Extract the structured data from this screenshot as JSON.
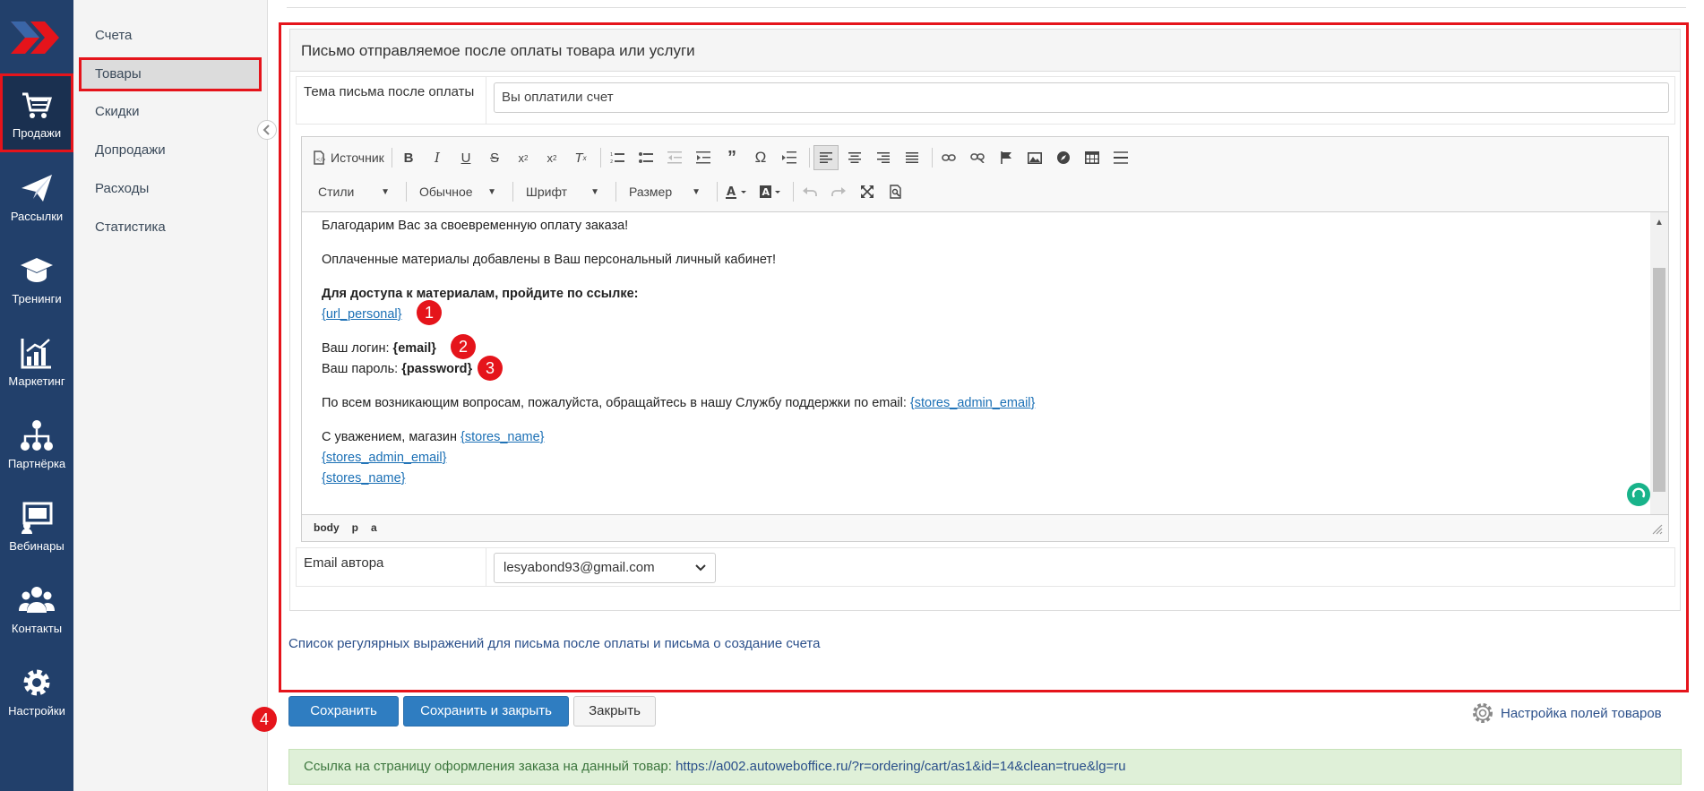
{
  "rail": {
    "items": [
      {
        "label": "Продажи",
        "icon": "cart-icon",
        "active": true
      },
      {
        "label": "Рассылки",
        "icon": "paper-plane-icon"
      },
      {
        "label": "Тренинги",
        "icon": "graduation-cap-icon"
      },
      {
        "label": "Маркетинг",
        "icon": "chart-growth-icon"
      },
      {
        "label": "Партнёрка",
        "icon": "network-icon"
      },
      {
        "label": "Вебинары",
        "icon": "presentation-icon"
      },
      {
        "label": "Контакты",
        "icon": "users-icon"
      },
      {
        "label": "Настройки",
        "icon": "gear-icon"
      }
    ]
  },
  "submenu": {
    "items": [
      "Счета",
      "Товары",
      "Скидки",
      "Допродажи",
      "Расходы",
      "Статистика"
    ],
    "active": "Товары"
  },
  "panel": {
    "title": "Письмо отправляемое после оплаты товара или услуги",
    "subject_label": "Тема письма после оплаты",
    "subject_value": "Вы оплатили счет",
    "author_label": "Email автора",
    "author_value": "lesyabond93@gmail.com"
  },
  "toolbar": {
    "source_label": "Источник",
    "styles_label": "Стили",
    "format_label": "Обычное",
    "font_label": "Шрифт",
    "size_label": "Размер"
  },
  "content": {
    "line1": "Благодарим Вас за своевременную оплату заказа!",
    "line2": "Оплаченные материалы добавлены в Ваш персональный личный кабинет!",
    "line3_bold": "Для доступа к материалам, пройдите по ссылке:",
    "url_personal": "{url_personal}",
    "login_label": "Ваш логин: ",
    "login_value": "{email}",
    "password_label": "Ваш пароль: ",
    "password_value": "{password}",
    "support_text": "По всем возникающим вопросам, пожалуйста, обращайтесь в нашу Службу поддержки по email: ",
    "support_email": "{stores_admin_email}",
    "regards_text": "С уважением, магазин ",
    "store_name": "{stores_name}",
    "footer_email": "{stores_admin_email}",
    "footer_store": "{stores_name}",
    "markers": [
      "1",
      "2",
      "3"
    ]
  },
  "statusbar": {
    "path": [
      "body",
      "p",
      "a"
    ]
  },
  "regex_link": "Список регулярных выражений для письма после оплаты и письма о создание счета",
  "actions": {
    "save": "Сохранить",
    "save_close": "Сохранить и закрыть",
    "close": "Закрыть",
    "marker": "4",
    "settings": "Настройка полей товаров"
  },
  "alert": {
    "text": "Ссылка на страницу оформления заказа на данный товар: ",
    "url": "https://a002.autoweboffice.ru/?r=ordering/cart/as1&id=14&clean=true&lg=ru"
  },
  "colors": {
    "rail": "#22406b",
    "highlight": "#e5141b",
    "primary": "#2f7dc1",
    "link": "#1a6fb5"
  }
}
